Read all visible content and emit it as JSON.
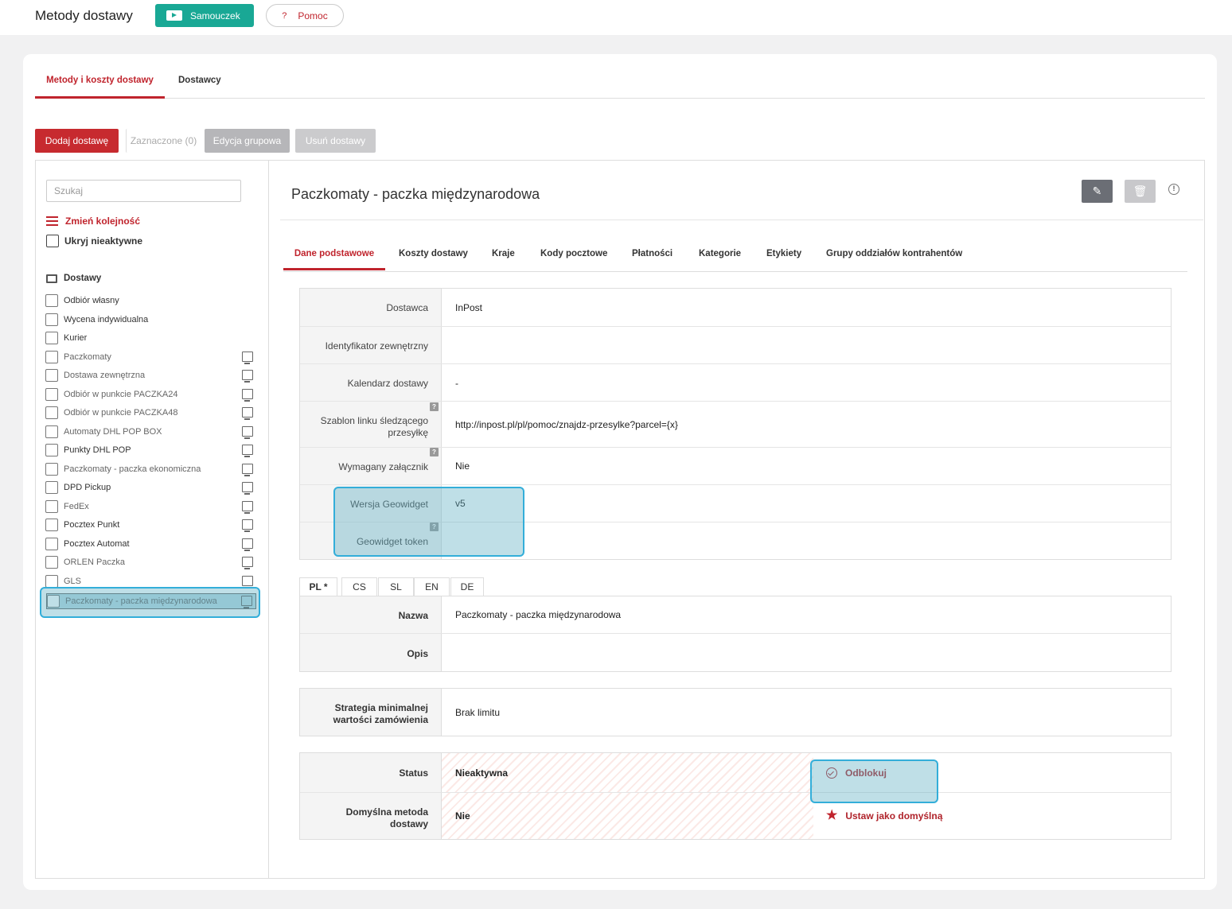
{
  "header": {
    "title": "Metody dostawy",
    "tutorial_label": "Samouczek",
    "help_label": "Pomoc",
    "help_icon": "?"
  },
  "tabs": {
    "main": "Metody i koszty dostawy",
    "suppliers": "Dostawcy"
  },
  "toolbar": {
    "add": "Dodaj dostawę",
    "selected": "Zaznaczone (0)",
    "group_edit": "Edycja grupowa",
    "delete": "Usuń dostawy"
  },
  "sidebar": {
    "search_placeholder": "Szukaj",
    "reorder": "Zmień kolejność",
    "hide_inactive": "Ukryj nieaktywne",
    "section": "Dostawy",
    "items": [
      {
        "label": "Odbiór własny",
        "active": true,
        "monitor": false
      },
      {
        "label": "Wycena indywidualna",
        "active": true,
        "monitor": false
      },
      {
        "label": "Kurier",
        "active": true,
        "monitor": false
      },
      {
        "label": "Paczkomaty",
        "active": false,
        "monitor": true
      },
      {
        "label": "Dostawa zewnętrzna",
        "active": false,
        "monitor": true
      },
      {
        "label": "Odbiór w punkcie PACZKA24",
        "active": false,
        "monitor": true
      },
      {
        "label": "Odbiór w punkcie PACZKA48",
        "active": false,
        "monitor": true
      },
      {
        "label": "Automaty DHL POP BOX",
        "active": false,
        "monitor": true
      },
      {
        "label": "Punkty DHL POP",
        "active": true,
        "monitor": true
      },
      {
        "label": "Paczkomaty - paczka ekonomiczna",
        "active": false,
        "monitor": true
      },
      {
        "label": "DPD Pickup",
        "active": true,
        "monitor": true
      },
      {
        "label": "FedEx",
        "active": false,
        "monitor": true
      },
      {
        "label": "Pocztex Punkt",
        "active": true,
        "monitor": true
      },
      {
        "label": "Pocztex Automat",
        "active": true,
        "monitor": true
      },
      {
        "label": "ORLEN Paczka",
        "active": false,
        "monitor": true
      },
      {
        "label": "GLS",
        "active": false,
        "monitor": true
      },
      {
        "label": "Paczkomaty - paczka międzynarodowa",
        "active": false,
        "monitor": true,
        "selected": true
      }
    ]
  },
  "detail": {
    "title": "Paczkomaty - paczka międzynarodowa",
    "tabs": [
      "Dane podstawowe",
      "Koszty dostawy",
      "Kraje",
      "Kody pocztowe",
      "Płatności",
      "Kategorie",
      "Etykiety",
      "Grupy oddziałów kontrahentów"
    ],
    "fields": {
      "supplier": {
        "label": "Dostawca",
        "value": "InPost"
      },
      "external_id": {
        "label": "Identyfikator zewnętrzny",
        "value": ""
      },
      "calendar": {
        "label": "Kalendarz dostawy",
        "value": "-"
      },
      "tracking": {
        "label": "Szablon linku śledzącego przesyłkę",
        "value": "http://inpost.pl/pl/pomoc/znajdz-przesylke?parcel={x}"
      },
      "attachment": {
        "label": "Wymagany załącznik",
        "value": "Nie"
      },
      "geowidget_version": {
        "label": "Wersja Geowidget",
        "value": "v5"
      },
      "geowidget_token": {
        "label": "Geowidget token",
        "value": ""
      }
    },
    "languages": [
      "PL *",
      "CS",
      "SL",
      "EN",
      "DE"
    ],
    "name": {
      "label": "Nazwa",
      "value": "Paczkomaty - paczka międzynarodowa"
    },
    "description": {
      "label": "Opis",
      "value": ""
    },
    "strategy": {
      "label": "Strategia minimalnej wartości zamówienia",
      "value": "Brak limitu"
    },
    "status": {
      "label": "Status",
      "value": "Nieaktywna",
      "action": "Odblokuj"
    },
    "default": {
      "label": "Domyślna metoda dostawy",
      "value": "Nie",
      "action": "Ustaw jako domyślną"
    }
  },
  "colors": {
    "accent": "#c0242d",
    "teal": "#19a895",
    "highlight": "#33aed9"
  }
}
